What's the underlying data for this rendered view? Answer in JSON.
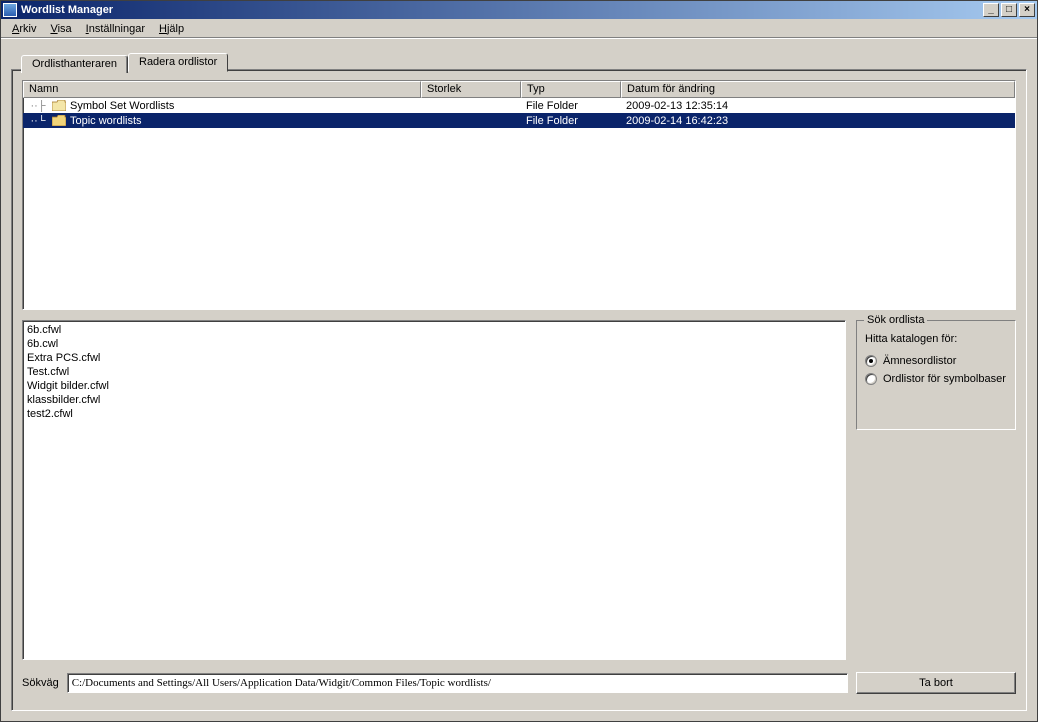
{
  "window": {
    "title": "Wordlist Manager"
  },
  "menu": {
    "arkiv": "Arkiv",
    "visa": "Visa",
    "installningar": "Inställningar",
    "hjalp": "Hjälp"
  },
  "tabs": {
    "t1": "Ordlisthanteraren",
    "t2": "Radera ordlistor"
  },
  "columns": {
    "name": "Namn",
    "size": "Storlek",
    "type": "Typ",
    "date": "Datum för ändring"
  },
  "folders": [
    {
      "name": "Symbol Set Wordlists",
      "type": "File Folder",
      "date": "2009-02-13 12:35:14",
      "selected": false
    },
    {
      "name": "Topic wordlists",
      "type": "File Folder",
      "date": "2009-02-14 16:42:23",
      "selected": true
    }
  ],
  "files": [
    "6b.cfwl",
    "6b.cwl",
    "Extra PCS.cfwl",
    "Test.cfwl",
    "Widgit bilder.cfwl",
    "klassbilder.cfwl",
    "test2.cfwl"
  ],
  "search": {
    "legend": "Sök ordlista",
    "label": "Hitta katalogen för:",
    "opt1": "Ämnesordlistor",
    "opt2": "Ordlistor för symbolbaser"
  },
  "path": {
    "label": "Sökväg",
    "value": "C:/Documents and Settings/All Users/Application Data/Widgit/Common Files/Topic wordlists/"
  },
  "delete_btn": "Ta bort",
  "winbtns": {
    "min": "_",
    "max": "□",
    "close": "×"
  }
}
